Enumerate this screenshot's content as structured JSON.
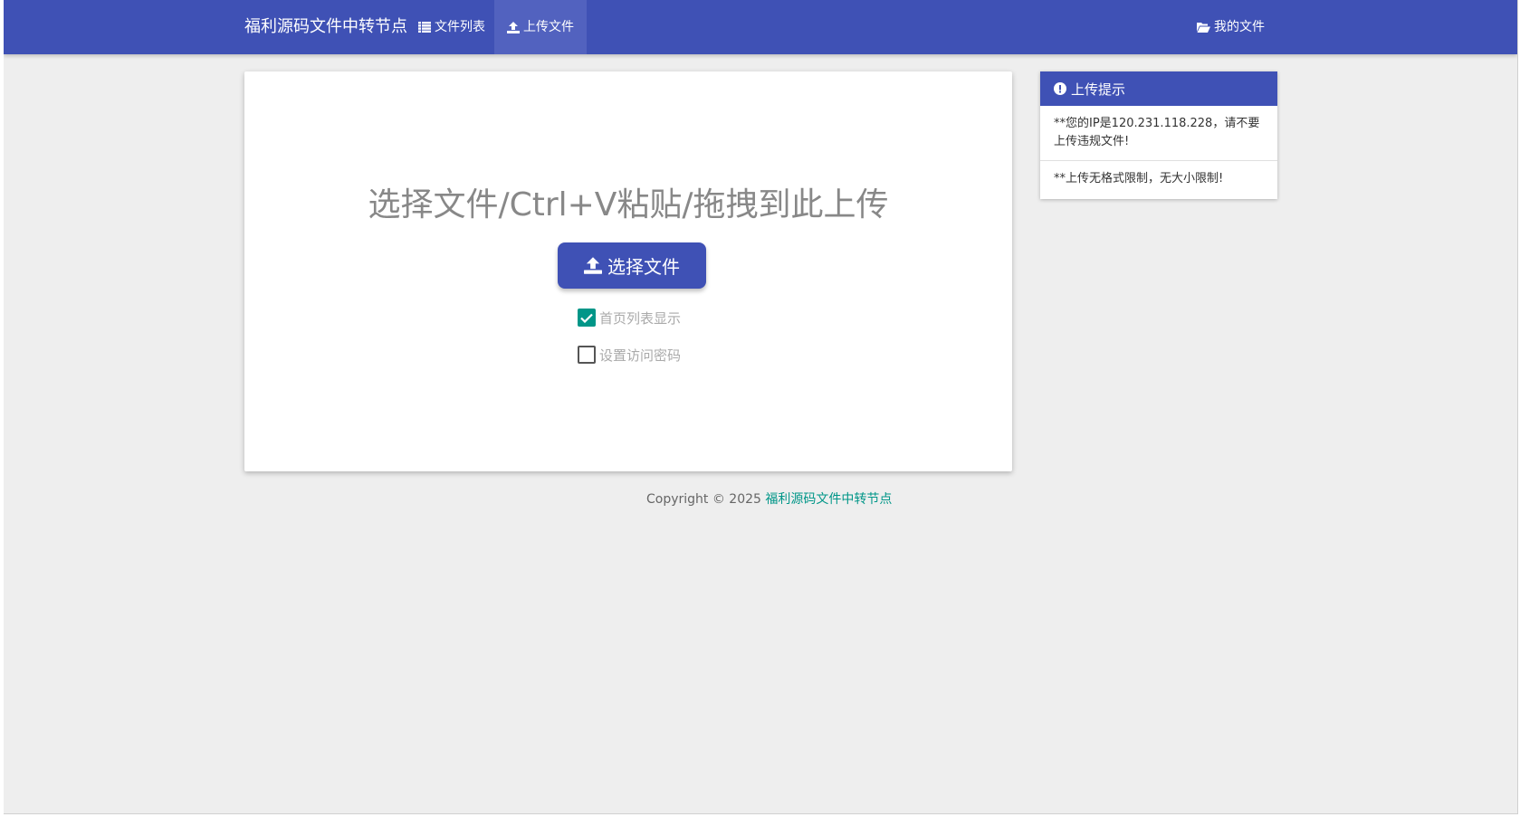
{
  "navbar": {
    "brand": "福利源码文件中转节点",
    "file_list_label": "文件列表",
    "upload_label": "上传文件",
    "my_files_label": "我的文件"
  },
  "upload": {
    "title": "选择文件/Ctrl+V粘贴/拖拽到此上传",
    "select_button": "选择文件",
    "show_on_home_label": "首页列表显示",
    "show_on_home_checked": true,
    "set_password_label": "设置访问密码",
    "set_password_checked": false
  },
  "footer": {
    "copyright": "Copyright © 2025",
    "site_name": "福利源码文件中转节点"
  },
  "sidebar": {
    "title": "上传提示",
    "tips": [
      "**您的IP是120.231.118.228，请不要上传违规文件!",
      "**上传无格式限制，无大小限制!"
    ]
  },
  "colors": {
    "primary": "#3f51b5",
    "accent": "#009688",
    "background": "#eeeeee"
  },
  "icons": {
    "file_list": "list-icon",
    "upload": "upload-icon",
    "my_files": "folder-open-icon",
    "tips": "exclamation-circle-icon",
    "checkbox_check": "check-icon"
  }
}
